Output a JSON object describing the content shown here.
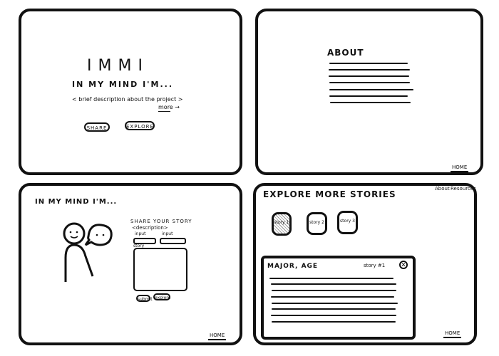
{
  "landing": {
    "logo": "IMMI",
    "tagline": "IN MY MIND I'M...",
    "description": "< brief description about the project >",
    "more_link": "more →",
    "share_button": "SHARE",
    "explore_button": "EXPLORE"
  },
  "about": {
    "title": "ABOUT",
    "home_link": "HOME"
  },
  "share_page": {
    "title": "IN MY MIND I'M...",
    "form_title": "SHARE YOUR STORY",
    "form_subtitle": "<description>",
    "input_label_1": "input",
    "input_label_2": "input",
    "story_label": "story",
    "submit_button": "submit",
    "explore_button": "explore",
    "home_link": "HOME"
  },
  "explore_page": {
    "title": "EXPLORE MORE STORIES",
    "nav": {
      "about": "About",
      "resources": "Resources"
    },
    "stories": [
      {
        "label": "story 1"
      },
      {
        "label": "story 2"
      },
      {
        "label": "story 3"
      }
    ],
    "modal": {
      "title": "MAJOR, AGE",
      "story_tag": "story #1",
      "close_icon": "close-icon"
    },
    "home_link": "HOME"
  }
}
